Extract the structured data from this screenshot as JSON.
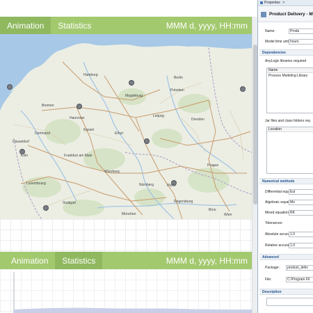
{
  "experiment": {
    "tabs_top": [
      "Animation",
      "Statistics"
    ],
    "tabs_bottom": [
      "Animation",
      "Statistics"
    ],
    "date_placeholder": "MMM d, yyyy, HH:mm"
  },
  "map": {
    "cities": [
      "Bremen",
      "Hamburg",
      "Hannover",
      "Berlin",
      "Dresden",
      "Leipzig",
      "Erfurt",
      "Magdeburg",
      "Potsdam",
      "Kassel",
      "Frankfurt am Main",
      "Nürnberg",
      "Prague",
      "Plzeň",
      "Wien",
      "Brno",
      "Würzburg",
      "Düsseldorf",
      "Köln",
      "Dortmund",
      "Luxembourg",
      "Stuttgart",
      "München",
      "Regensburg"
    ]
  },
  "properties": {
    "tab_label": "Properties",
    "title": "Product Delivery - M",
    "name_label": "Name:",
    "name_value": "Produ",
    "model_time_units_label": "Model time units:",
    "model_time_units_value": "hours",
    "dependencies_header": "Dependencies",
    "anylogic_libs_label": "AnyLogic libraries required",
    "libs_column_header": "Name",
    "libs_row": "Process Modeling Library",
    "jar_files_label": "Jar files and class folders req",
    "jar_column_header": "Location",
    "numerical_methods_header": "Numerical methods",
    "differential_label": "Differential equations:",
    "differential_value": "Eul",
    "algebraic_label": "Algebraic equations:",
    "algebraic_value": "Mo",
    "mixed_label": "Mixed equations:",
    "mixed_value": "RK",
    "tolerances_label": "Tolerances:",
    "absolute_label": "Absolute accuracy:",
    "absolute_value": "1.0",
    "relative_label": "Relative accuracy:",
    "relative_value": "1.0",
    "advanced_header": "Advanced",
    "package_label": "Package:",
    "package_value": "product_deliv",
    "file_label": "File:",
    "file_value": "C:\\Program Fil",
    "description_header": "Description"
  }
}
